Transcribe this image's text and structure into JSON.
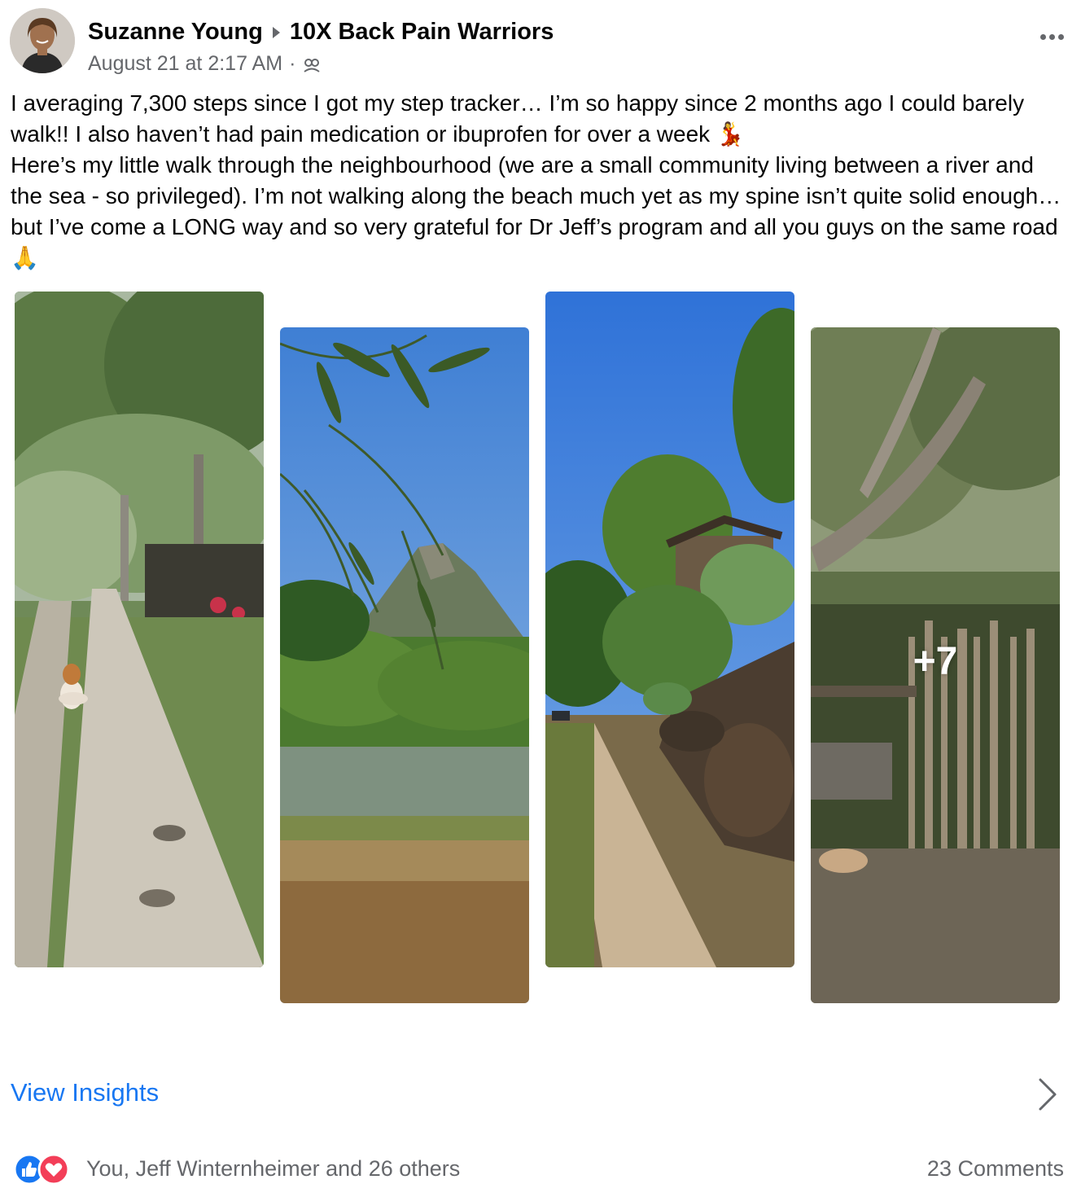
{
  "post": {
    "author": "Suzanne Young",
    "group": "10X Back Pain Warriors",
    "timestamp": "August 21 at 2:17 AM",
    "separator": "·",
    "privacy_icon": "group-privacy-icon",
    "text_lines": [
      "I averaging 7,300 steps since I got my step tracker… I’m so happy since 2 months ago I could barely walk!! I also haven’t had pain medication or ibuprofen for over a week 💃",
      "Here’s my little  walk through the neighbourhood (we are a small community living between a river and the sea - so privileged). I’m not walking along the beach much yet as my spine isn’t quite solid enough… but I’ve come a LONG way and so very grateful for Dr Jeff’s program and all you guys on the same road 🙏"
    ]
  },
  "photos": {
    "more_count": "+7"
  },
  "footer": {
    "insights_label": "View Insights",
    "reactions_text": "You, Jeff Winternheimer and 26 others",
    "comments_text": "23 Comments"
  },
  "colors": {
    "link": "#1877f2",
    "secondary_text": "#65676b",
    "like": "#1877f2",
    "love": "#f33e58"
  }
}
